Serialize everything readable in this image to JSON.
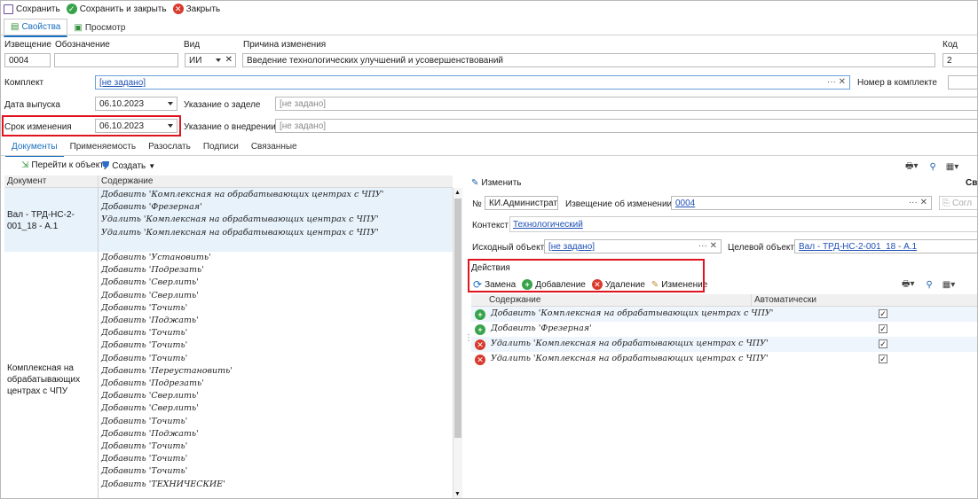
{
  "toolbar": {
    "save": "Сохранить",
    "save_close": "Сохранить и закрыть",
    "close": "Закрыть"
  },
  "tabs": {
    "properties": "Свойства",
    "preview": "Просмотр"
  },
  "form": {
    "notice_label": "Извещение",
    "notice_value": "0004",
    "designation_label": "Обозначение",
    "designation_value": "",
    "kind_label": "Вид",
    "kind_value": "ИИ",
    "reason_label": "Причина изменения",
    "reason_value": "Введение технологических улучшений и усовершенствований",
    "code_label": "Код",
    "code_value": "2",
    "kit_label": "Комплект",
    "kit_value": "[не задано]",
    "kit_number_label": "Номер в комплекте",
    "release_label": "Дата выпуска",
    "release_value": "06.10.2023",
    "backlog_label": "Указание о заделе",
    "backlog_value": "[не задано]",
    "term_label": "Срок изменения",
    "term_value": "06.10.2023",
    "impl_label": "Указание о внедрении",
    "impl_value": "[не задано]"
  },
  "subtabs": [
    "Документы",
    "Применяемость",
    "Разослать",
    "Подписи",
    "Связанные"
  ],
  "doc_toolbar": {
    "goto": "Перейти к объекту",
    "create": "Создать"
  },
  "doc_grid": {
    "col_doc": "Документ",
    "col_content": "Содержание",
    "row1_doc": "Вал - ТРД-НС-2-001_18 - А.1",
    "row1_lines": [
      "Добавить 'Комплексная на обрабатывающих центрах с ЧПУ'",
      "Добавить 'Фрезерная'",
      "Удалить 'Комплексная на обрабатывающих центрах с ЧПУ'",
      "Удалить 'Комплексная на обрабатывающих центрах с ЧПУ'"
    ],
    "row2_doc": "Комплексная на обрабатывающих центрах с ЧПУ",
    "row2_lines": [
      "Добавить 'Установить'",
      "Добавить 'Подрезать'",
      "Добавить 'Сверлить'",
      "Добавить 'Сверлить'",
      "Добавить 'Точить'",
      "Добавить 'Поджать'",
      "Добавить 'Точить'",
      "Добавить 'Точить'",
      "Добавить 'Точить'",
      "Добавить 'Переустановить'",
      "Добавить 'Подрезать'",
      "Добавить 'Сверлить'",
      "Добавить 'Сверлить'",
      "Добавить 'Точить'",
      "Добавить 'Поджать'",
      "Добавить 'Точить'",
      "Добавить 'Точить'",
      "Добавить 'Точить'",
      "Добавить 'ТЕХНИЧЕСКИЕ'"
    ]
  },
  "right": {
    "edit": "Изменить",
    "props_cut": "Сво",
    "no_label": "№",
    "no_value": "КИ.Администратор",
    "notice_label": "Извещение об изменении",
    "notice_value": "0004",
    "agree_cut": "Согл",
    "context_label": "Контекст",
    "context_value": "Технологический",
    "source_label": "Исходный объект",
    "source_value": "[не задано]",
    "target_label": "Целевой объект",
    "target_value": "Вал - ТРД-НС-2-001_18 - А.1",
    "actions_title": "Действия",
    "btn_replace": "Замена",
    "btn_add": "Добавление",
    "btn_delete": "Удаление",
    "btn_change": "Изменение",
    "col_content": "Содержание",
    "col_auto": "Автоматически",
    "rows": [
      {
        "type": "add",
        "text": "Добавить 'Комплексная на обрабатывающих центрах с ЧПУ'"
      },
      {
        "type": "add",
        "text": "Добавить 'Фрезерная'"
      },
      {
        "type": "del",
        "text": "Удалить 'Комплексная на обрабатывающих центрах с ЧПУ'"
      },
      {
        "type": "del",
        "text": "Удалить 'Комплексная на обрабатывающих центрах с ЧПУ'"
      }
    ]
  }
}
